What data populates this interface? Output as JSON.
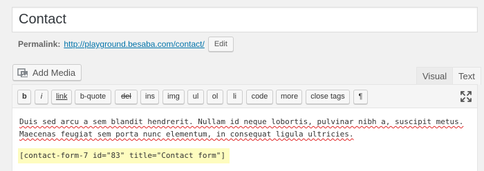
{
  "title": {
    "value": "Contact"
  },
  "permalink": {
    "label": "Permalink:",
    "url": "http://playground.besaba.com/contact/",
    "edit_label": "Edit"
  },
  "media": {
    "add_media_label": "Add Media"
  },
  "editor_tabs": {
    "visual": "Visual",
    "text": "Text"
  },
  "toolbar": {
    "buttons": [
      "b",
      "i",
      "link",
      "b-quote",
      "del",
      "ins",
      "img",
      "ul",
      "ol",
      "li",
      "code",
      "more",
      "close tags",
      "¶"
    ]
  },
  "content": {
    "line1": "Duis sed arcu a sem blandit hendrerit. Nullam id neque lobortis, pulvinar nibh a, suscipit metus.",
    "line2": "Maecenas feugiat sem porta nunc elementum, in consequat ligula ultricies.",
    "shortcode": "[contact-form-7 id=\"83\" title=\"Contact form\"]"
  }
}
